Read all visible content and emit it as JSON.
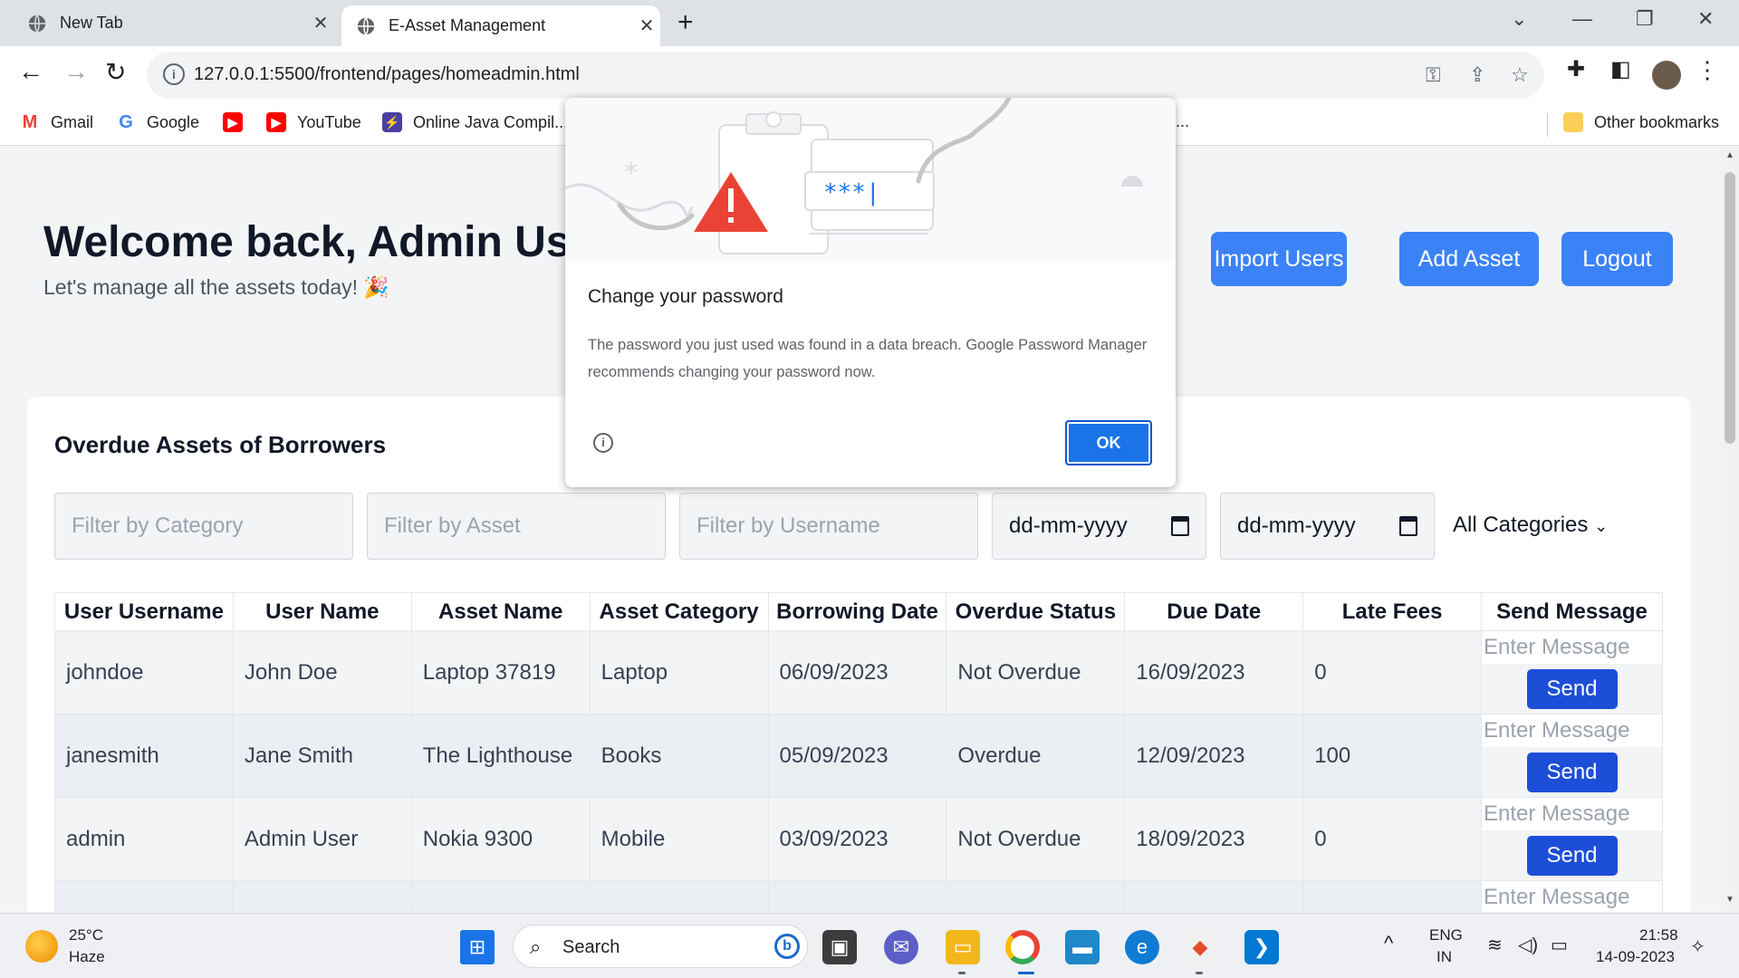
{
  "browser": {
    "tabs": [
      {
        "title": "New Tab"
      },
      {
        "title": "E-Asset Management"
      }
    ],
    "url": "127.0.0.1:5500/frontend/pages/homeadmin.html",
    "bookmarks": [
      {
        "label": "Gmail",
        "icon": "gmail-icon"
      },
      {
        "label": "Google",
        "icon": "google-icon"
      },
      {
        "label": "",
        "icon": "youtube-icon"
      },
      {
        "label": "YouTube",
        "icon": "youtube-icon"
      },
      {
        "label": "Online Java Compil...",
        "icon": "java-compiler-icon"
      }
    ],
    "bookmark_overflow": "...",
    "other_bookmarks": "Other bookmarks"
  },
  "header": {
    "welcome": "Welcome back, Admin Us",
    "subtitle": "Let's manage all the assets today! 🎉",
    "buttons": {
      "import_users": "Import Users",
      "add_asset": "Add Asset",
      "logout": "Logout"
    }
  },
  "overdue": {
    "title": "Overdue Assets of Borrowers",
    "filters": {
      "category_placeholder": "Filter by Category",
      "asset_placeholder": "Filter by Asset",
      "username_placeholder": "Filter by Username",
      "date_from": "dd-mm-yyyy",
      "date_to": "dd-mm-yyyy",
      "category_select": "All Categories"
    },
    "columns": [
      "User Username",
      "User Name",
      "Asset Name",
      "Asset Category",
      "Borrowing Date",
      "Overdue Status",
      "Due Date",
      "Late Fees",
      "Send Message"
    ],
    "rows": [
      {
        "username": "johndoe",
        "name": "John Doe",
        "asset": "Laptop 37819",
        "category": "Laptop",
        "borrowed": "06/09/2023",
        "status": "Not Overdue",
        "due": "16/09/2023",
        "fees": "0"
      },
      {
        "username": "janesmith",
        "name": "Jane Smith",
        "asset": "The Lighthouse",
        "category": "Books",
        "borrowed": "05/09/2023",
        "status": "Overdue",
        "due": "12/09/2023",
        "fees": "100"
      },
      {
        "username": "admin",
        "name": "Admin User",
        "asset": "Nokia 9300",
        "category": "Mobile",
        "borrowed": "03/09/2023",
        "status": "Not Overdue",
        "due": "18/09/2023",
        "fees": "0"
      }
    ],
    "message_placeholder": "Enter Message",
    "send_label": "Send"
  },
  "dialog": {
    "title": "Change your password",
    "body": "The password you just used was found in a data breach. Google Password Manager recommends changing your password now.",
    "ok": "OK",
    "masked": "***|"
  },
  "taskbar": {
    "temp": "25°C",
    "weather": "Haze",
    "search": "Search",
    "lang": "ENG",
    "region": "IN",
    "time": "21:58",
    "date": "14-09-2023"
  },
  "colors": {
    "primary_button": "#3b82f6",
    "send_button": "#1d4ed8",
    "dialog_ok": "#1a73e8",
    "warning_red": "#ea4335"
  }
}
